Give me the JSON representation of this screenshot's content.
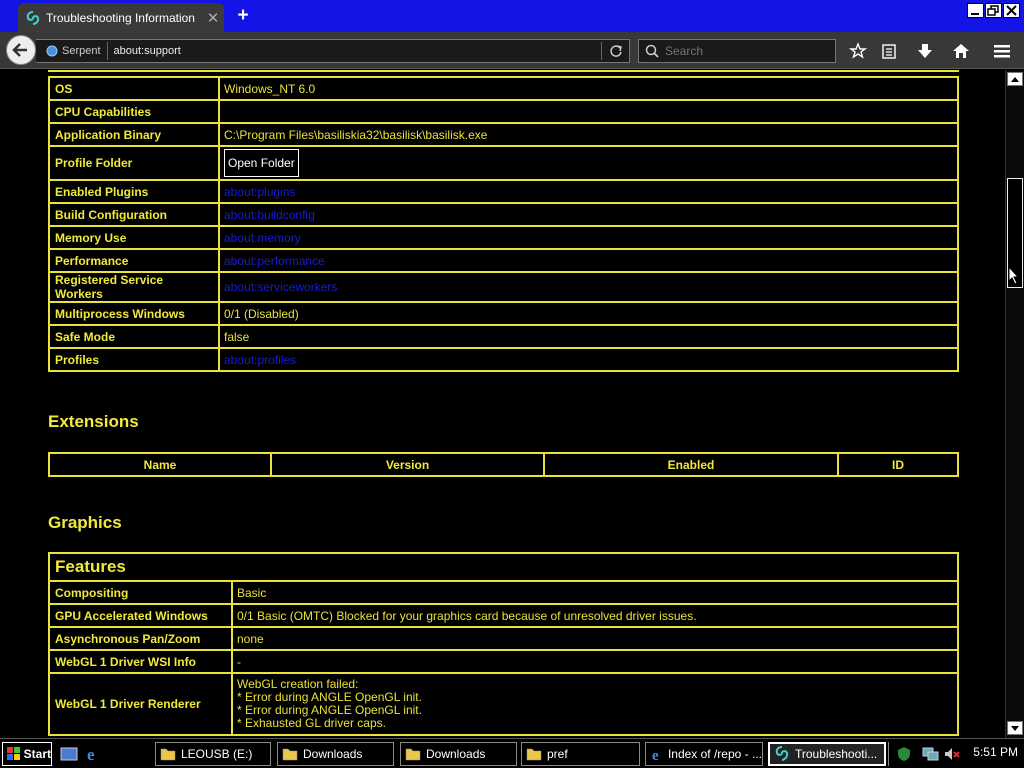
{
  "window": {
    "tab_title": "Troubleshooting Information",
    "new_tab_symbol": "+"
  },
  "navbar": {
    "identity_label": "Serpent",
    "url": "about:support",
    "search_placeholder": "Search"
  },
  "app_basics_rows": [
    {
      "label": "OS",
      "value": "Windows_NT 6.0",
      "type": "text"
    },
    {
      "label": "CPU Capabilities",
      "value": "",
      "type": "text"
    },
    {
      "label": "Application Binary",
      "value": "C:\\Program Files\\basiliskia32\\basilisk\\basilisk.exe",
      "type": "text"
    },
    {
      "label": "Profile Folder",
      "value": "Open Folder",
      "type": "button"
    },
    {
      "label": "Enabled Plugins",
      "value": "about:plugins",
      "type": "link"
    },
    {
      "label": "Build Configuration",
      "value": "about:buildconfig",
      "type": "link"
    },
    {
      "label": "Memory Use",
      "value": "about:memory",
      "type": "link"
    },
    {
      "label": "Performance",
      "value": "about:performance",
      "type": "link"
    },
    {
      "label": "Registered Service Workers",
      "value": "about:serviceworkers",
      "type": "link"
    },
    {
      "label": "Multiprocess Windows",
      "value": "0/1 (Disabled)",
      "type": "text"
    },
    {
      "label": "Safe Mode",
      "value": "false",
      "type": "text"
    },
    {
      "label": "Profiles",
      "value": "about:profiles",
      "type": "link"
    }
  ],
  "extensions": {
    "heading": "Extensions",
    "columns": [
      "Name",
      "Version",
      "Enabled",
      "ID"
    ]
  },
  "graphics": {
    "heading": "Graphics",
    "features_caption": "Features",
    "rows": [
      {
        "label": "Compositing",
        "value": "Basic"
      },
      {
        "label": "GPU Accelerated Windows",
        "value": "0/1 Basic (OMTC) Blocked for your graphics card because of unresolved driver issues."
      },
      {
        "label": "Asynchronous Pan/Zoom",
        "value": "none"
      },
      {
        "label": "WebGL 1 Driver WSI Info",
        "value": "-"
      },
      {
        "label": "WebGL 1 Driver Renderer",
        "value_lines": [
          "WebGL creation failed:",
          "* Error during ANGLE OpenGL init.",
          "* Error during ANGLE OpenGL init.",
          "* Exhausted GL driver caps."
        ]
      }
    ]
  },
  "taskbar": {
    "start_label": "Start",
    "tasks": [
      "LEOUSB (E:)",
      "Downloads",
      "Downloads",
      "pref",
      "Index of /repo - ...",
      "Troubleshooti..."
    ],
    "clock": "5:51 PM"
  },
  "colors": {
    "accent_yellow": "#e8e23a",
    "link_blue": "#1a1ad8",
    "titlebar_blue": "#1414e6",
    "background": "#000000"
  }
}
